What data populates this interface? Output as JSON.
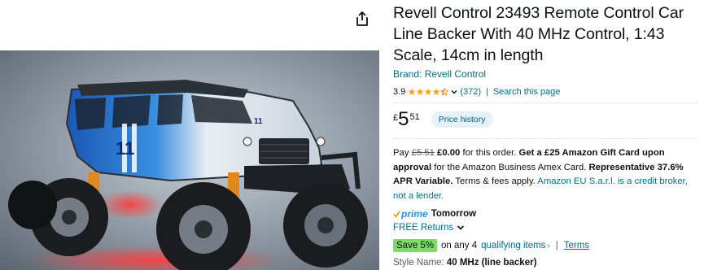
{
  "product": {
    "title": "Revell Control 23493 Remote Control Car Line Backer With 40 MHz Control, 1:43 Scale, 14cm in length",
    "brand_link": "Brand: Revell Control",
    "rating_value": "3.9",
    "rating_stars": 3.9,
    "review_count": "(372)",
    "separator": "|",
    "search_link": "Search this page"
  },
  "price": {
    "symbol": "£",
    "whole": "5",
    "fraction": "51",
    "history_button": "Price history"
  },
  "promo": {
    "pay": "Pay",
    "old_price": "£5.51",
    "new_price": "£0.00",
    "for_order": "for this order.",
    "gift_card": "Get a £25 Amazon Gift Card upon approval",
    "for_card": "for the Amazon Business Amex Card.",
    "apr": "Representative 37.6% APR Variable.",
    "terms_fees": "Terms & fees apply.",
    "credit_broker": "Amazon EU S.a.r.l. is a credit broker, not a lender."
  },
  "delivery": {
    "prime_label": "prime",
    "day": "Tomorrow",
    "returns": "FREE Returns"
  },
  "save": {
    "badge": "Save 5%",
    "on_any": "on any 4",
    "qualifying_items": "qualifying items",
    "chevron": "›",
    "pipe": "|",
    "terms": "Terms"
  },
  "style": {
    "label": "Style Name:",
    "value": "40 MHz (line backer)"
  },
  "colors": {
    "link": "#007185",
    "star": "#ffa41c",
    "prime": "#1399ff",
    "save_badge": "#7fda69",
    "price_history_bg": "#e6f2f7"
  },
  "icons": {
    "share": "share-icon",
    "star": "star-icon",
    "chevron": "chevron-down-icon",
    "prime": "prime-check-icon"
  }
}
